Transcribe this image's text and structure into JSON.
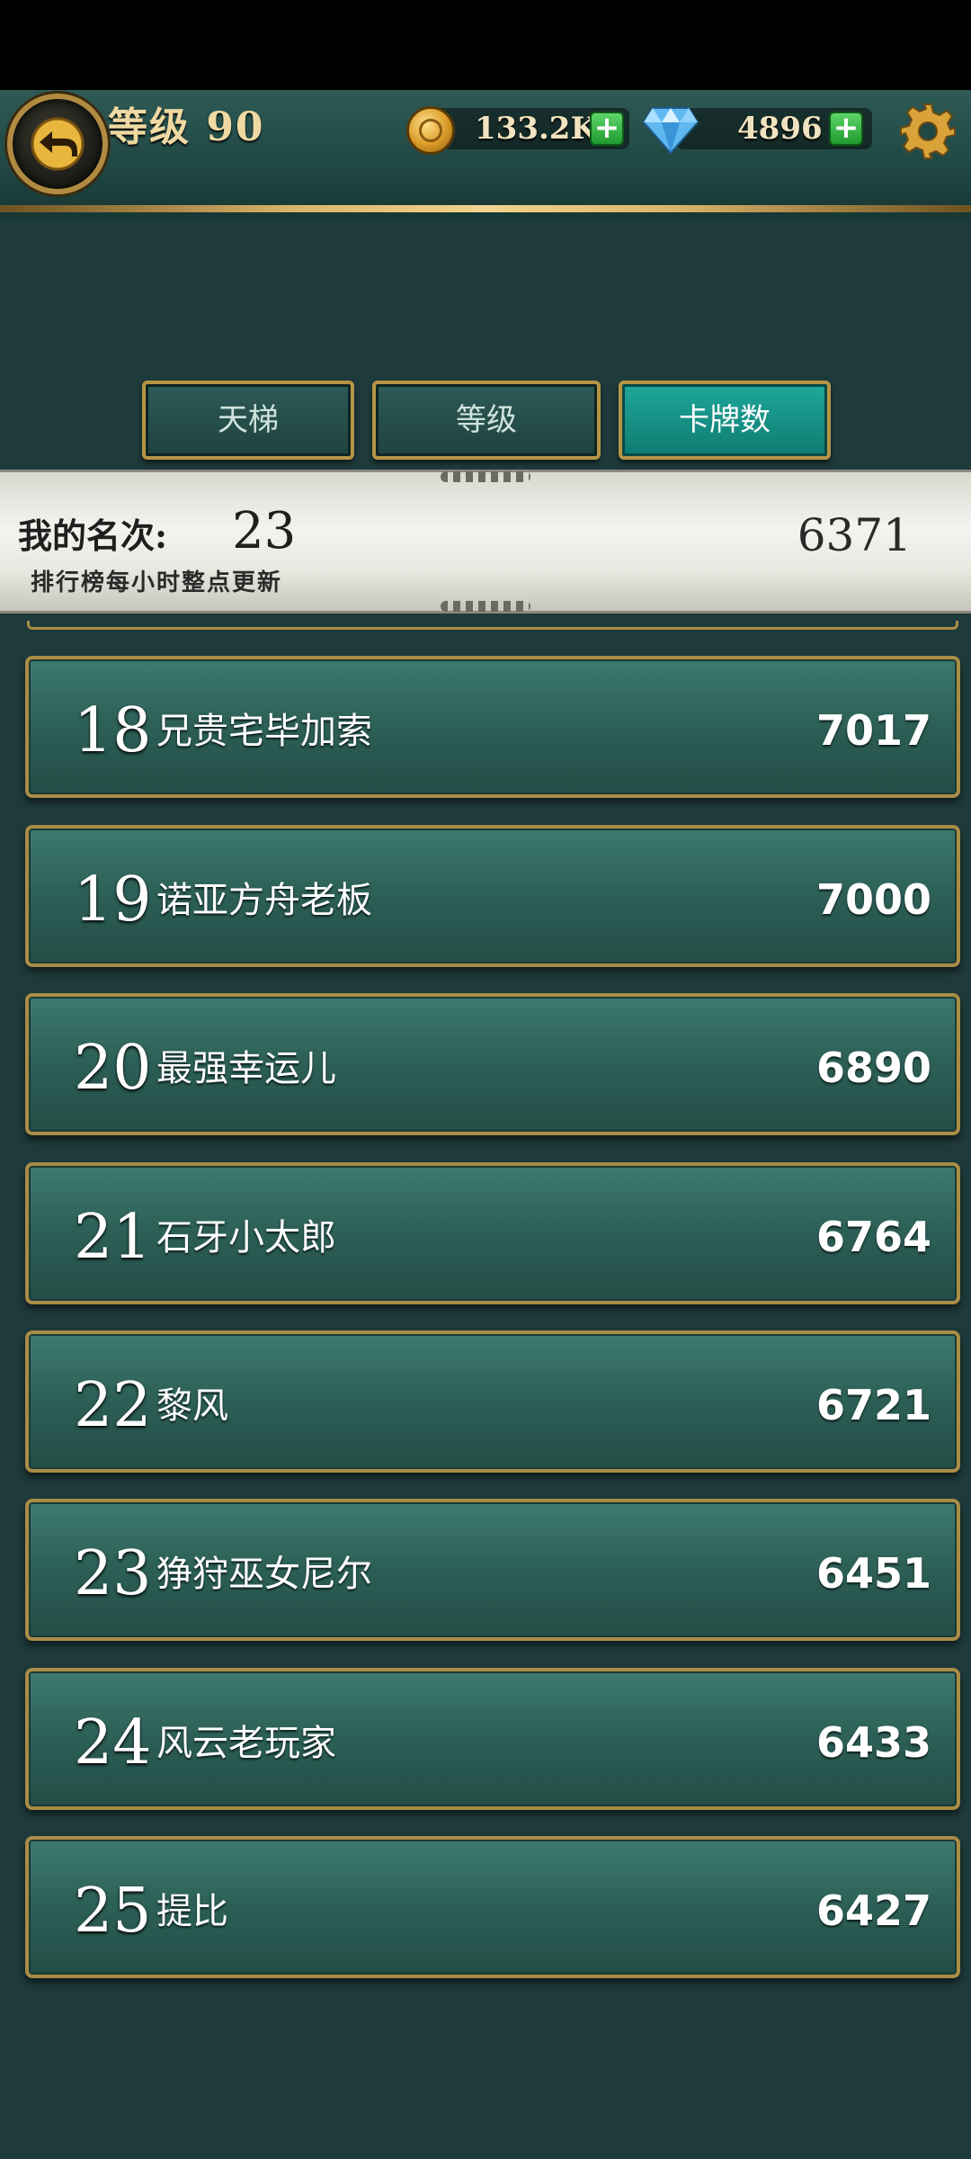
{
  "header": {
    "level_label": "等级 90",
    "coins": "133.2K",
    "gems": "4896",
    "plus": "+"
  },
  "tabs": [
    {
      "label": "天梯",
      "active": false
    },
    {
      "label": "等级",
      "active": false
    },
    {
      "label": "卡牌数",
      "active": true
    }
  ],
  "my_rank": {
    "label": "我的名次:",
    "rank": "23",
    "score": "6371",
    "note": "排行榜每小时整点更新"
  },
  "leaderboard": [
    {
      "rank": "18",
      "name": "兄贵宅毕加索",
      "score": "7017"
    },
    {
      "rank": "19",
      "name": "诺亚方舟老板",
      "score": "7000"
    },
    {
      "rank": "20",
      "name": "最强幸运儿",
      "score": "6890"
    },
    {
      "rank": "21",
      "name": "石牙小太郎",
      "score": "6764"
    },
    {
      "rank": "22",
      "name": "黎风",
      "score": "6721"
    },
    {
      "rank": "23",
      "name": "狰狩巫女尼尔",
      "score": "6451"
    },
    {
      "rank": "24",
      "name": "风云老玩家",
      "score": "6433"
    },
    {
      "rank": "25",
      "name": "提比",
      "score": "6427"
    }
  ],
  "icons": {
    "back": "back-arrow-icon",
    "coin": "coin-icon",
    "gem": "diamond-icon",
    "settings": "gear-icon"
  }
}
